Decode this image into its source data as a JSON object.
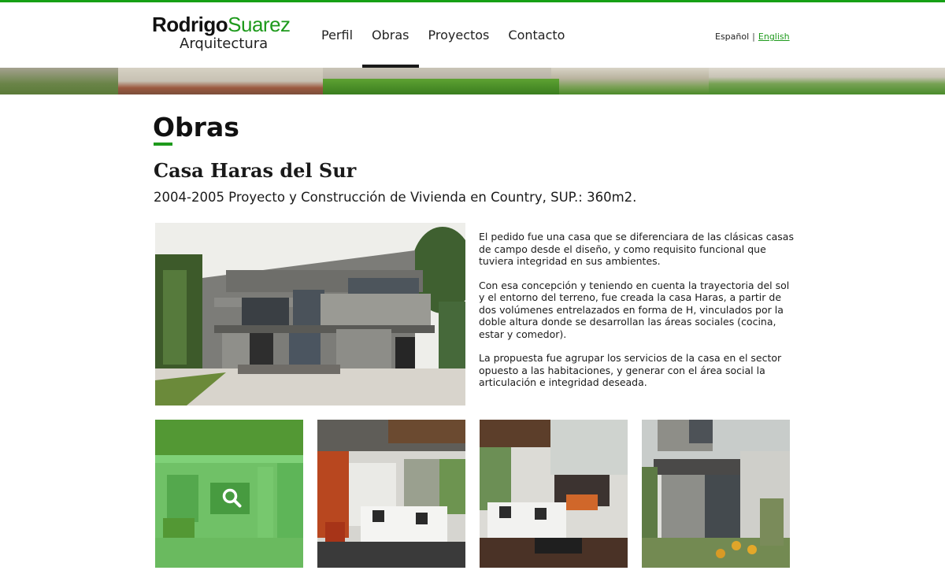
{
  "brand": {
    "first": "Rodrigo",
    "last": "Suarez",
    "subtitle": "Arquitectura"
  },
  "nav": {
    "items": [
      {
        "label": "Perfil",
        "active": false
      },
      {
        "label": "Obras",
        "active": true
      },
      {
        "label": "Proyectos",
        "active": false
      },
      {
        "label": "Contacto",
        "active": false
      }
    ]
  },
  "language": {
    "es": "Español",
    "separator": "|",
    "en": "English",
    "current": "English"
  },
  "page": {
    "title": "Obras"
  },
  "project": {
    "name": "Casa Haras del Sur",
    "meta": "2004-2005 Proyecto y Construcción de Vivienda en Country, SUP.: 360m2.",
    "paragraphs": [
      "El pedido fue una casa que se diferenciara de las clásicas casas de campo desde el diseño, y como requisito funcional que tuviera integridad en sus ambientes.",
      "Con esa concepción  y teniendo en cuenta la trayectoria del sol y el entorno del terreno,  fue creada la casa Haras, a partir de dos volúmenes entrelazados en forma de H, vinculados por la doble altura donde se desarrollan las áreas sociales (cocina, estar y comedor).",
      "La propuesta fue agrupar los servicios de la casa en el sector opuesto a las habitaciones, y generar con el área social la articulación e integridad deseada."
    ]
  },
  "colors": {
    "accent": "#1e9a1c",
    "thumb_overlay": "#3abe30"
  },
  "icons": {
    "thumb_hover": "search-icon"
  }
}
